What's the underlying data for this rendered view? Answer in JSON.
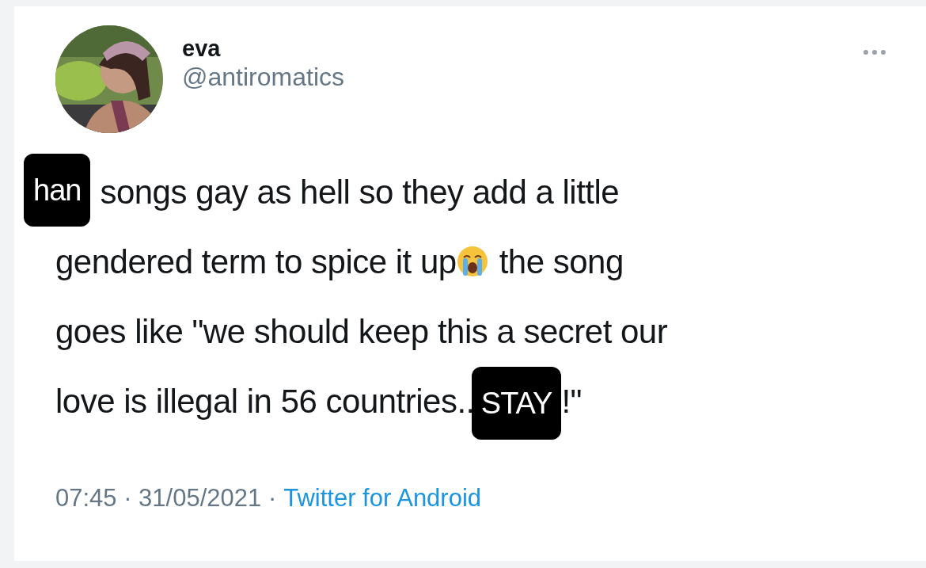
{
  "author": {
    "name": "eva",
    "handle": "@antiromatics"
  },
  "body": {
    "lines": [
      {
        "parts": [
          {
            "kind": "sticker",
            "text": "han"
          },
          {
            "kind": "text",
            "text": "songs gay as hell so they add a little"
          }
        ]
      },
      {
        "parts": [
          {
            "kind": "text",
            "text": "gendered term to spice it up"
          },
          {
            "kind": "emoji"
          },
          {
            "kind": "text",
            "text": "the song"
          }
        ]
      },
      {
        "parts": [
          {
            "kind": "text",
            "text": "goes like \"we should keep this a secret our"
          }
        ]
      },
      {
        "parts": [
          {
            "kind": "text",
            "text": "love is illegal in 56 countries.."
          },
          {
            "kind": "sticker",
            "text": "STAY"
          },
          {
            "kind": "text",
            "text": "!\""
          }
        ]
      }
    ]
  },
  "meta": [
    {
      "kind": "text",
      "text": "07:45 · 31/05/2021 ·"
    },
    {
      "kind": "link",
      "text": "Twitter for Android"
    }
  ]
}
